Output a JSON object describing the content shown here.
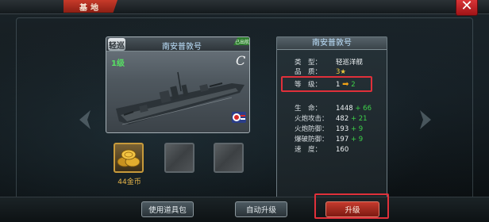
{
  "header": {
    "tab_label": "基地",
    "close_symbol": "✕"
  },
  "ship_card": {
    "name": "南安普敦号",
    "class_badge": "轻巡",
    "corner_tag": "已出航",
    "level": "1级",
    "grade": "C"
  },
  "items": [
    {
      "label": "44金币",
      "icon": "gold-coins-icon"
    },
    {
      "label": "",
      "icon": "empty-slot-icon"
    },
    {
      "label": "",
      "icon": "empty-slot-icon"
    }
  ],
  "info_panel": {
    "title": "南安普敦号",
    "rows": [
      {
        "label": "类　型：",
        "value": "轻巡洋舰",
        "inc": ""
      },
      {
        "label": "品　质：",
        "value": "3★",
        "inc": ""
      },
      {
        "label": "等　级：",
        "value": "1",
        "inc": "2"
      },
      {
        "label": "生　命：",
        "value": "1448",
        "inc": "+ 66"
      },
      {
        "label": "火炮攻击：",
        "value": "482",
        "inc": "+ 21"
      },
      {
        "label": "火炮防御：",
        "value": "193",
        "inc": "+ 9"
      },
      {
        "label": "爆破防御：",
        "value": "197",
        "inc": "+ 9"
      },
      {
        "label": "速　度：",
        "value": "160",
        "inc": ""
      }
    ]
  },
  "buttons": {
    "use_item_pack": "使用道具包",
    "auto_upgrade": "自动升级",
    "upgrade": "升级"
  },
  "colors": {
    "accent_red": "#e0303a",
    "increase_green": "#3ed24a",
    "level_green": "#57e063",
    "arrow_orange": "#f3a316"
  }
}
